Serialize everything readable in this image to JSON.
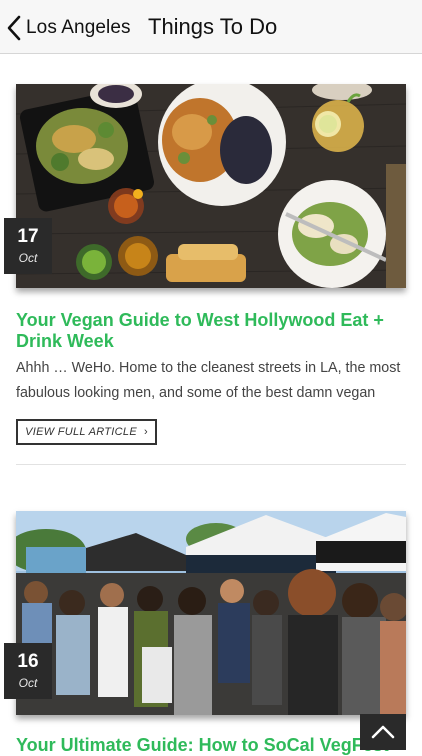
{
  "header": {
    "back_label": "Los Angeles",
    "title": "Things To Do"
  },
  "articles": [
    {
      "day": "17",
      "month": "Oct",
      "title": "Your Vegan Guide to West Hollywood Eat + Drink Week",
      "excerpt": "Ahhh … WeHo. Home to the cleanest streets in LA, the most fabulous looking men, and some of the best damn vegan",
      "cta": "VIEW FULL ARTICLE"
    },
    {
      "day": "16",
      "month": "Oct",
      "title": "Your Ultimate Guide: How to SoCal VegFest"
    }
  ],
  "colors": {
    "accent_green": "#2fba5a",
    "badge_bg": "#2a2a2a",
    "header_bg": "#f7f7f7"
  },
  "icons": {
    "back": "chevron-left-icon",
    "article_link": "chevron-right-icon",
    "scroll_top": "chevron-up-icon"
  }
}
